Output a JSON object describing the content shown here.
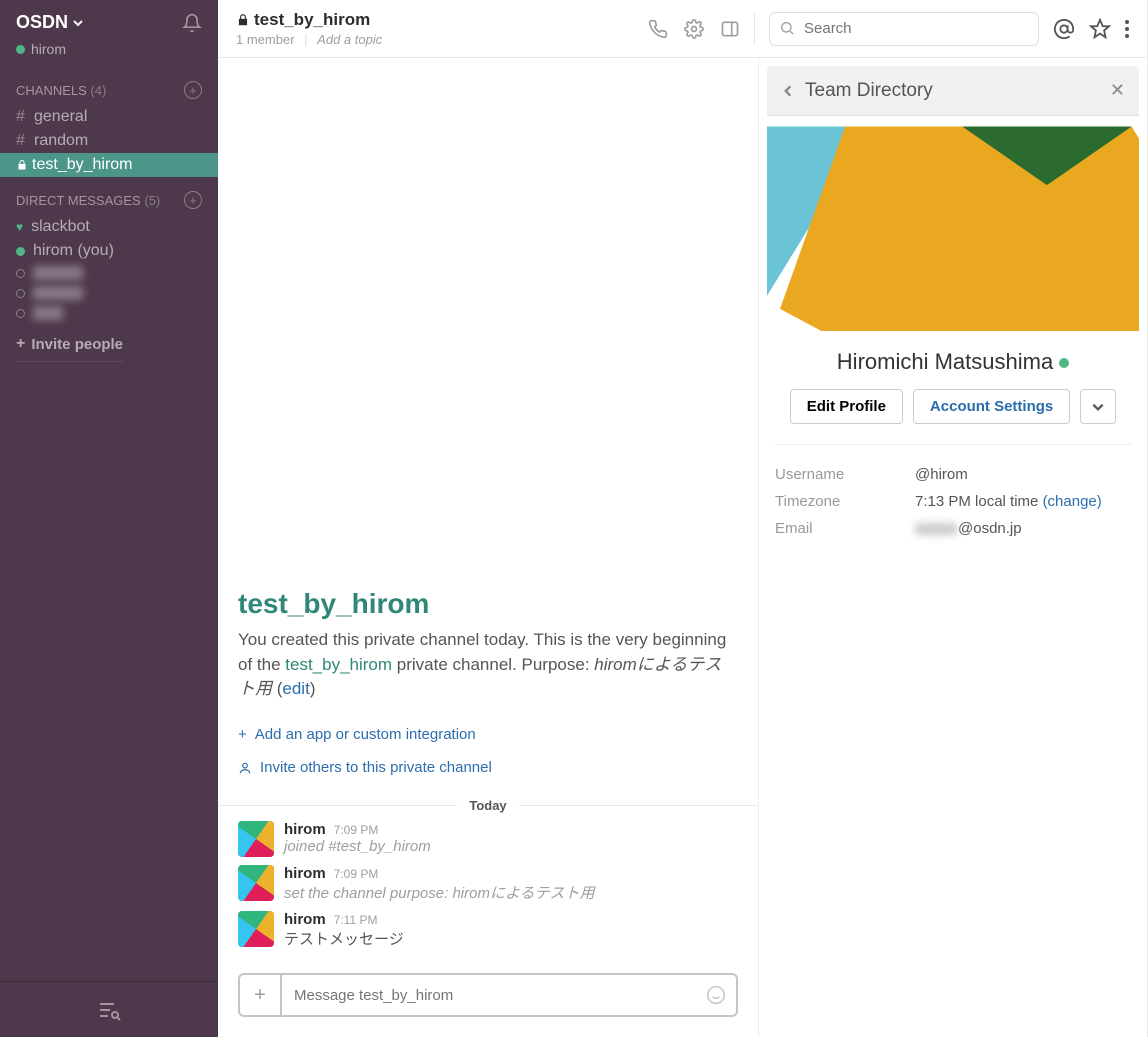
{
  "sidebar": {
    "team_name": "OSDN",
    "user": "hirom",
    "channels_label": "CHANNELS",
    "channels_count": "(4)",
    "channels": [
      {
        "prefix": "#",
        "name": "general"
      },
      {
        "prefix": "#",
        "name": "random"
      },
      {
        "prefix": "🔒",
        "name": "test_by_hirom",
        "active": true
      }
    ],
    "dm_label": "DIRECT MESSAGES",
    "dm_count": "(5)",
    "dms": [
      {
        "name": "slackbot",
        "icon": "heart"
      },
      {
        "name": "hirom (you)",
        "icon": "online"
      },
      {
        "name": "",
        "icon": "away",
        "blur": true
      },
      {
        "name": "",
        "icon": "away",
        "blur": true
      },
      {
        "name": "",
        "icon": "away",
        "blur": true
      }
    ],
    "invite": "Invite people"
  },
  "header": {
    "channel_name": "test_by_hirom",
    "members": "1 member",
    "topic": "Add a topic",
    "search_placeholder": "Search"
  },
  "intro": {
    "title": "test_by_hirom",
    "text1": "You created this private channel today. This is the very beginning of the ",
    "link": "test_by_hirom",
    "text2": " private channel. Purpose: ",
    "purpose": "hiromによるテスト用",
    "edit": "edit",
    "add_app": "Add an app or custom integration",
    "invite": "Invite others to this private channel"
  },
  "divider": "Today",
  "messages": [
    {
      "name": "hirom",
      "time": "7:09 PM",
      "text": "joined #test_by_hirom",
      "sys": true
    },
    {
      "name": "hirom",
      "time": "7:09 PM",
      "text": "set the channel purpose: hiromによるテスト用",
      "sys": true
    },
    {
      "name": "hirom",
      "time": "7:11 PM",
      "text": "テストメッセージ",
      "sys": false
    }
  ],
  "composer": {
    "placeholder": "Message test_by_hirom"
  },
  "profile": {
    "panel_title": "Team Directory",
    "name": "Hiromichi Matsushima",
    "edit_btn": "Edit Profile",
    "settings_btn": "Account Settings",
    "username_label": "Username",
    "username": "@hirom",
    "timezone_label": "Timezone",
    "timezone": "7:13 PM local time ",
    "timezone_change": "(change)",
    "email_label": "Email",
    "email_suffix": "@osdn.jp"
  }
}
